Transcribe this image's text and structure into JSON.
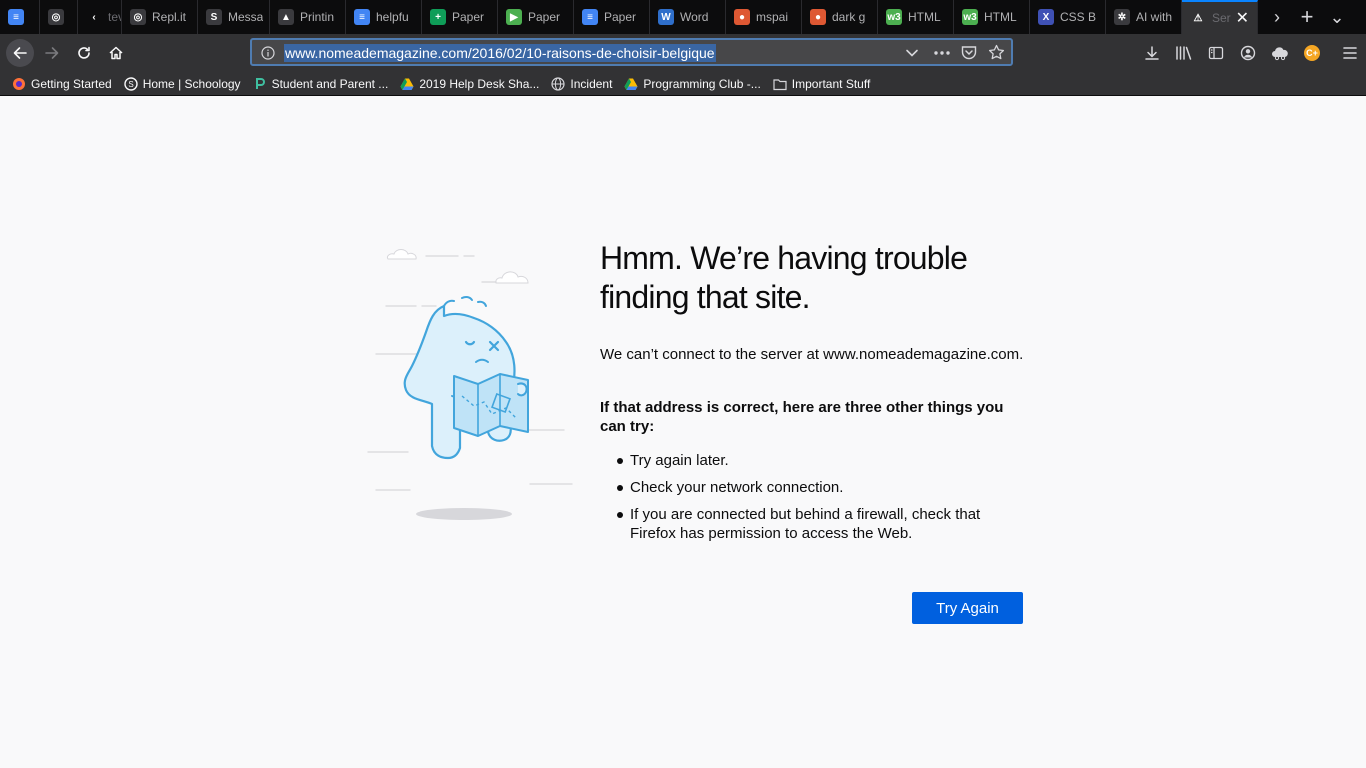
{
  "tabs": [
    {
      "label": "",
      "favicon": "google-docs-icon",
      "color": "#4285f4",
      "glyph": "≡",
      "fade": false
    },
    {
      "label": "",
      "favicon": "replit-icon",
      "color": "#3a3a3e",
      "glyph": "◎",
      "fade": false
    },
    {
      "label": "tev",
      "favicon": "back-arrow-icon",
      "color": "#0c0c0d",
      "glyph": "‹",
      "fade": true
    },
    {
      "label": "Repl.it",
      "favicon": "replit-icon",
      "color": "#3a3a3e",
      "glyph": "◎",
      "fade": false
    },
    {
      "label": "Messa",
      "favicon": "schoology-icon",
      "color": "#3a3a3e",
      "glyph": "S",
      "fade": false
    },
    {
      "label": "Printin",
      "favicon": "google-drive-icon",
      "color": "#3a3a3e",
      "glyph": "▲",
      "fade": false
    },
    {
      "label": "helpfu",
      "favicon": "google-docs-icon",
      "color": "#4285f4",
      "glyph": "≡",
      "fade": false
    },
    {
      "label": "Paper",
      "favicon": "google-sheets-icon",
      "color": "#0f9d58",
      "glyph": "+",
      "fade": false
    },
    {
      "label": "Paper",
      "favicon": "google-slides-icon",
      "color": "#4caf50",
      "glyph": "▶",
      "fade": false
    },
    {
      "label": "Paper",
      "favicon": "google-docs-icon",
      "color": "#4285f4",
      "glyph": "≡",
      "fade": false
    },
    {
      "label": "Word",
      "favicon": "word-icon",
      "color": "#2f6fcb",
      "glyph": "W",
      "fade": false
    },
    {
      "label": "mspai",
      "favicon": "duckduckgo-icon",
      "color": "#de5833",
      "glyph": "●",
      "fade": false
    },
    {
      "label": "dark g",
      "favicon": "duckduckgo-icon",
      "color": "#de5833",
      "glyph": "●",
      "fade": false
    },
    {
      "label": "HTML",
      "favicon": "w3-icon",
      "color": "#4caf50",
      "glyph": "w3",
      "fade": false
    },
    {
      "label": "HTML",
      "favicon": "w3-icon",
      "color": "#4caf50",
      "glyph": "w3",
      "fade": false
    },
    {
      "label": "CSS B",
      "favicon": "x-icon",
      "color": "#3f51b5",
      "glyph": "X",
      "fade": false
    },
    {
      "label": "AI with",
      "favicon": "openai-icon",
      "color": "#3a3a3e",
      "glyph": "✲",
      "fade": false
    },
    {
      "label": "Ser",
      "favicon": "warning-icon",
      "color": "#323234",
      "glyph": "⚠",
      "fade": true
    }
  ],
  "url": "www.nomeademagazine.com/2016/02/10-raisons-de-choisir-belgique",
  "bookmarks": [
    {
      "label": "Getting Started",
      "icon": "firefox-icon"
    },
    {
      "label": "Home | Schoology",
      "icon": "schoology-icon"
    },
    {
      "label": "Student and Parent ...",
      "icon": "powerschool-icon"
    },
    {
      "label": "2019 Help Desk Sha...",
      "icon": "google-drive-icon"
    },
    {
      "label": "Incident",
      "icon": "globe-icon"
    },
    {
      "label": "Programming Club -...",
      "icon": "google-drive-icon"
    },
    {
      "label": "Important Stuff",
      "icon": "folder-icon"
    }
  ],
  "error": {
    "title": "Hmm. We’re having trouble finding that site.",
    "description": "We can’t connect to the server at www.nomeademagazine.com.",
    "try_header": "If that address is correct, here are three other things you can try:",
    "suggestions": [
      "Try again later.",
      "Check your network connection.",
      "If you are connected but behind a firewall, check that Firefox has permission to access the Web."
    ],
    "button": "Try Again"
  },
  "colors": {
    "accent": "#0060df",
    "tab_active_border": "#0a84ff",
    "chrome_dark": "#0c0c0d",
    "toolbar": "#323234",
    "page_bg": "#f9f9fa",
    "illustration": "#4fb0e0"
  }
}
